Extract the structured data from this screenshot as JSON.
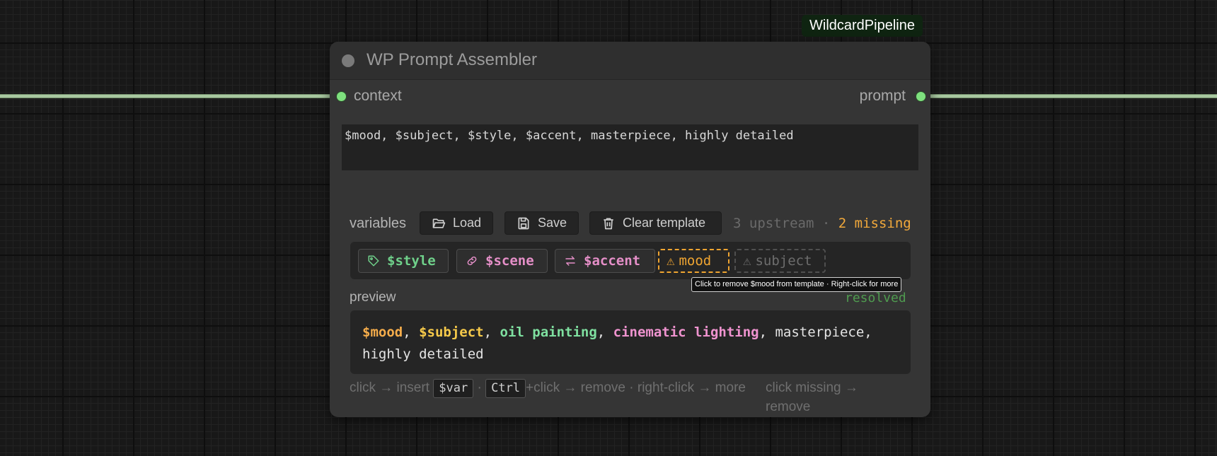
{
  "group": {
    "title": "WildcardPipeline"
  },
  "node": {
    "title": "WP Prompt Assembler",
    "input_slot": "context",
    "output_slot": "prompt",
    "template_text": "$mood, $subject, $style, $accent, masterpiece, highly detailed"
  },
  "variables": {
    "label": "variables",
    "buttons": {
      "load": "Load",
      "save": "Save",
      "clear": "Clear template"
    },
    "status": {
      "upstream": "3 upstream",
      "separator": "·",
      "missing": "2 missing"
    },
    "chips": [
      {
        "text": "$style",
        "icon": "tag-icon",
        "color": "#6fd08a",
        "state": "defined"
      },
      {
        "text": "$scene",
        "icon": "link-icon",
        "color": "#e58fc8",
        "state": "defined"
      },
      {
        "text": "$accent",
        "icon": "swap-icon",
        "color": "#e58fc8",
        "state": "defined"
      },
      {
        "text": "mood",
        "icon": "warning-icon",
        "color": "#f0a531",
        "state": "missing"
      },
      {
        "text": "subject",
        "icon": "warning-icon",
        "color": "#6d6d6d",
        "state": "missing"
      }
    ],
    "tooltip": "Click to remove $mood from template · Right-click for more"
  },
  "preview": {
    "label": "preview",
    "status": "resolved",
    "tokens": [
      {
        "text": "$mood",
        "color": "#f6ad4b",
        "bold": true
      },
      {
        "text": ", ",
        "color": "#e4e4e4",
        "bold": false
      },
      {
        "text": "$subject",
        "color": "#f5c94a",
        "bold": true
      },
      {
        "text": ", ",
        "color": "#e4e4e4",
        "bold": false
      },
      {
        "text": "oil painting",
        "color": "#7fe0a0",
        "bold": true
      },
      {
        "text": ", ",
        "color": "#e4e4e4",
        "bold": false
      },
      {
        "text": "cinematic lighting",
        "color": "#ef93cf",
        "bold": true
      },
      {
        "text": ", masterpiece,",
        "color": "#e4e4e4",
        "bold": false
      },
      {
        "text": " highly detailed",
        "color": "#e4e4e4",
        "bold": false
      }
    ]
  },
  "footer": {
    "part1": "click → insert ",
    "kbd1": "$var",
    "part2": " · ",
    "kbd2": "Ctrl",
    "part3": "+click → remove · right-click → more",
    "right": "click missing → remove"
  },
  "colors": {
    "slot": "#7ee07e",
    "wire": "#a8c8a0",
    "missing": "#f0a531",
    "resolved": "#4f9a4f"
  }
}
